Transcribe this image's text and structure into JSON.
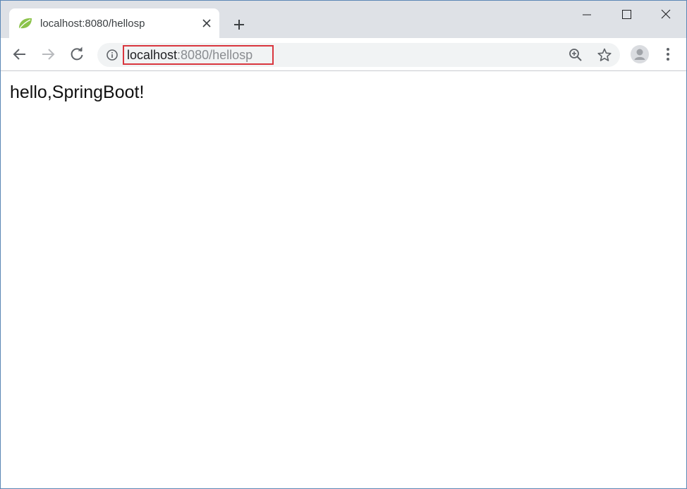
{
  "tab": {
    "title": "localhost:8080/hellosp",
    "favicon": "spring-leaf-icon",
    "favicon_color": "#6db33f"
  },
  "address_bar": {
    "host": "localhost",
    "path": ":8080/hellosp",
    "highlight_color": "#d9363e"
  },
  "page": {
    "body_text": "hello,SpringBoot!"
  },
  "icons": {
    "back": "arrow-left-icon",
    "forward": "arrow-right-icon",
    "reload": "reload-icon",
    "info": "info-icon",
    "zoom": "zoom-in-icon",
    "bookmark": "star-icon",
    "profile": "avatar-icon",
    "menu": "kebab-menu-icon",
    "new_tab": "plus-icon",
    "close_tab": "close-icon",
    "minimize": "minimize-icon",
    "maximize": "maximize-icon",
    "close_window": "close-icon"
  }
}
